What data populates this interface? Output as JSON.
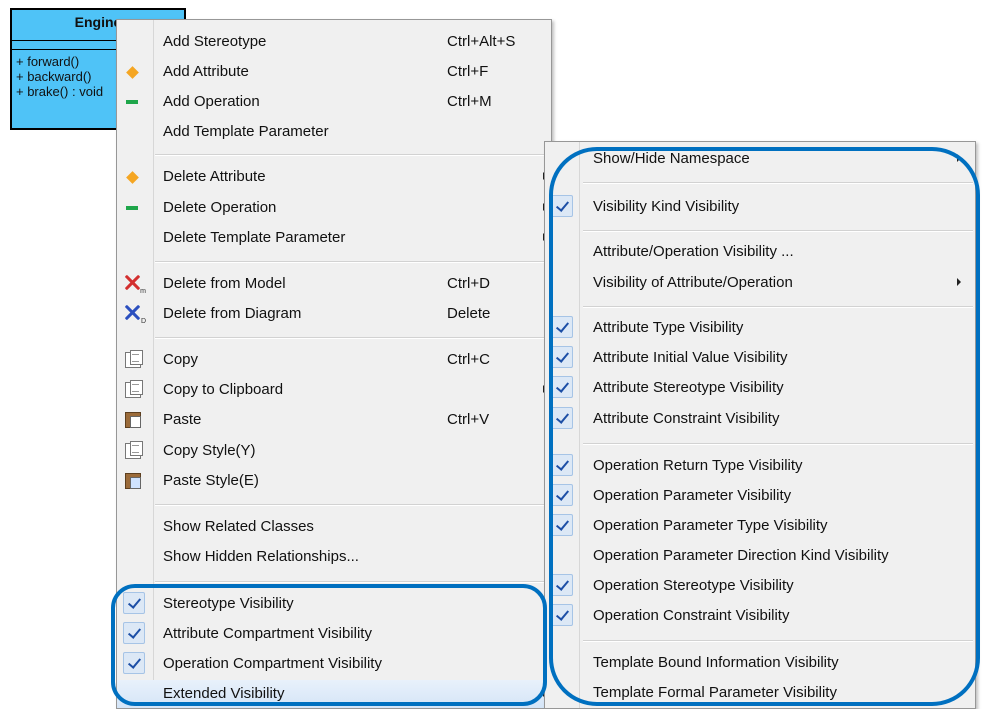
{
  "uml_class": {
    "name": "Engine",
    "operations": [
      "+ forward()",
      "+ backward()",
      "+ brake() : void"
    ]
  },
  "context_menu": {
    "items": [
      {
        "label": "Add Stereotype",
        "shortcut": "Ctrl+Alt+S"
      },
      {
        "label": "Add Attribute",
        "shortcut": "Ctrl+F",
        "icon": "attribute-diamond-icon"
      },
      {
        "label": "Add Operation",
        "shortcut": "Ctrl+M",
        "icon": "operation-dash-icon"
      },
      {
        "label": "Add Template Parameter"
      },
      {
        "label": "Delete Attribute",
        "icon": "attribute-diamond-icon",
        "submenu": true
      },
      {
        "label": "Delete Operation",
        "icon": "operation-dash-icon",
        "submenu": true
      },
      {
        "label": "Delete Template Parameter",
        "submenu": true
      },
      {
        "label": "Delete from Model",
        "shortcut": "Ctrl+D",
        "icon": "delete-from-model-icon"
      },
      {
        "label": "Delete from Diagram",
        "shortcut": "Delete",
        "icon": "delete-from-diagram-icon"
      },
      {
        "label": "Copy",
        "shortcut": "Ctrl+C",
        "icon": "copy-icon"
      },
      {
        "label": "Copy to Clipboard",
        "icon": "copy-icon",
        "submenu": true
      },
      {
        "label": "Paste",
        "shortcut": "Ctrl+V",
        "icon": "paste-icon"
      },
      {
        "label": "Copy Style(Y)",
        "icon": "copy-style-icon"
      },
      {
        "label": "Paste Style(E)",
        "icon": "paste-style-icon"
      },
      {
        "label": "Show Related Classes"
      },
      {
        "label": "Show Hidden Relationships..."
      },
      {
        "label": "Stereotype Visibility",
        "checked": true
      },
      {
        "label": "Attribute Compartment Visibility",
        "checked": true
      },
      {
        "label": "Operation Compartment Visibility",
        "checked": true
      },
      {
        "label": "Extended Visibility",
        "submenu": true,
        "highlighted": true
      }
    ]
  },
  "submenu": {
    "items": [
      {
        "label": "Show/Hide Namespace",
        "submenu": true
      },
      {
        "label": "Visibility Kind Visibility",
        "checked": true
      },
      {
        "label": "Attribute/Operation Visibility ..."
      },
      {
        "label": "Visibility of Attribute/Operation",
        "submenu": true
      },
      {
        "label": "Attribute Type Visibility",
        "checked": true
      },
      {
        "label": "Attribute Initial Value Visibility",
        "checked": true
      },
      {
        "label": "Attribute Stereotype Visibility",
        "checked": true
      },
      {
        "label": "Attribute Constraint Visibility",
        "checked": true
      },
      {
        "label": "Operation Return Type Visibility",
        "checked": true
      },
      {
        "label": "Operation Parameter Visibility",
        "checked": true
      },
      {
        "label": "Operation Parameter Type Visibility",
        "checked": true
      },
      {
        "label": "Operation Parameter Direction Kind Visibility"
      },
      {
        "label": "Operation Stereotype Visibility",
        "checked": true
      },
      {
        "label": "Operation Constraint Visibility",
        "checked": true
      },
      {
        "label": "Template Bound Information Visibility"
      },
      {
        "label": "Template Formal Parameter Visibility"
      }
    ]
  },
  "colors": {
    "uml_fill": "#4fc3f7",
    "menu_background": "#f0f0f0",
    "callout_outline": "#0070c0",
    "check_mark": "#1d4fa6"
  }
}
